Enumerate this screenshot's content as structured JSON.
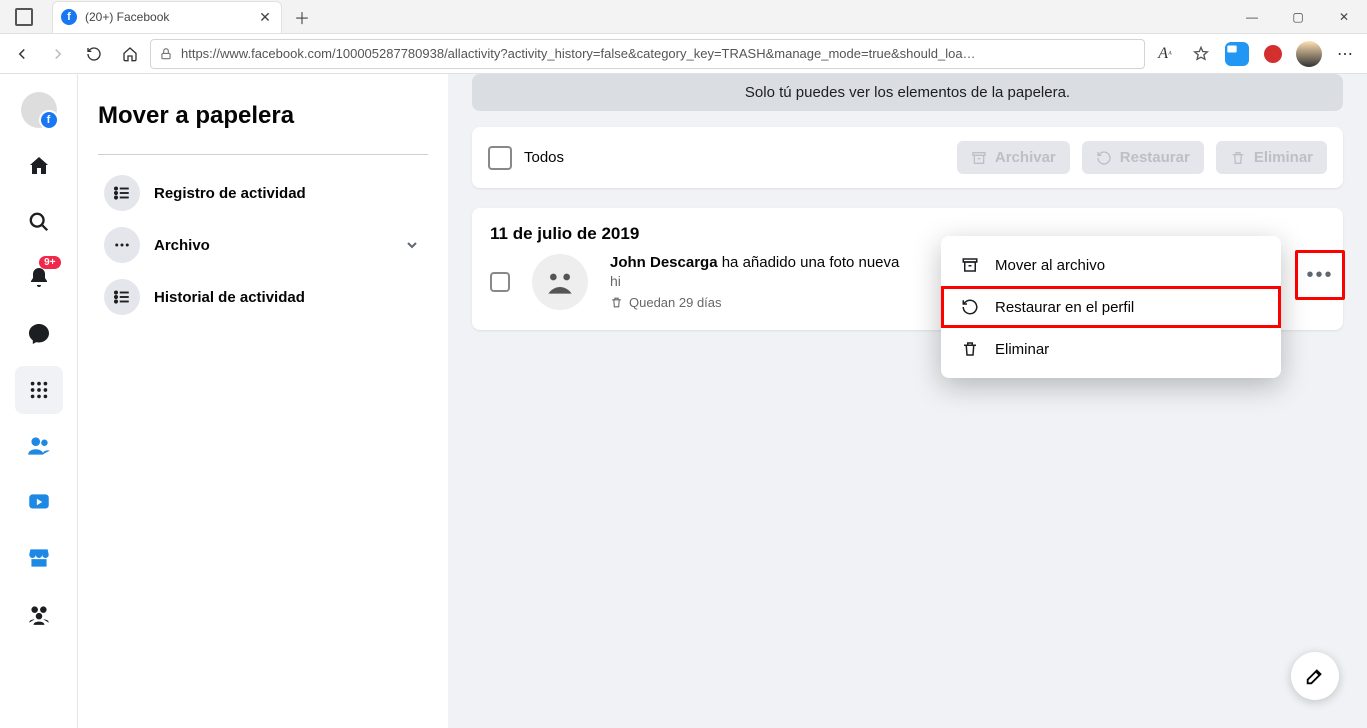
{
  "browser": {
    "tab_title": "(20+) Facebook",
    "url": "https://www.facebook.com/100005287780938/allactivity?activity_history=false&category_key=TRASH&manage_mode=true&should_loa…"
  },
  "rail": {
    "notifications_count": "9+"
  },
  "sidebar": {
    "title": "Mover a papelera",
    "items": [
      {
        "label": "Registro de actividad"
      },
      {
        "label": "Archivo"
      },
      {
        "label": "Historial de actividad"
      }
    ]
  },
  "notice": "Solo tú puedes ver los elementos de la papelera.",
  "toolbar": {
    "all_label": "Todos",
    "archive_label": "Archivar",
    "restore_label": "Restaurar",
    "delete_label": "Eliminar"
  },
  "context_menu": {
    "archive": "Mover al archivo",
    "restore": "Restaurar en el perfil",
    "delete": "Eliminar"
  },
  "feed": {
    "date_heading": "11 de julio de 2019",
    "post": {
      "author": "John Descarga",
      "action": " ha añadido una foto nueva",
      "subtext": "hi",
      "remaining": "Quedan 29 días"
    }
  }
}
